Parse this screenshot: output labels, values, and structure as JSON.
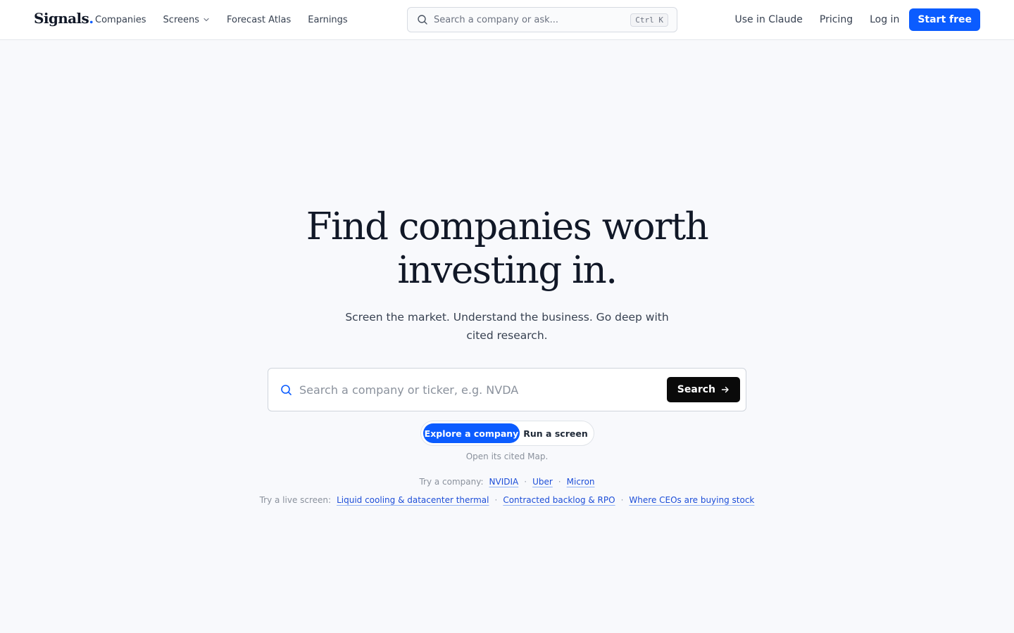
{
  "header": {
    "logo": "Signals",
    "logo_dot": ".",
    "nav": [
      {
        "label": "Companies"
      },
      {
        "label": "Screens"
      },
      {
        "label": "Forecast Atlas"
      },
      {
        "label": "Earnings"
      }
    ],
    "search": {
      "placeholder": "Search a company or ask...",
      "shortcut": "Ctrl K"
    },
    "right_links": [
      {
        "label": "Use in Claude"
      },
      {
        "label": "Pricing"
      },
      {
        "label": "Log in"
      }
    ],
    "cta": "Start free"
  },
  "hero": {
    "title_line1": "Find companies worth",
    "title_line2": "investing in.",
    "subtitle": "Screen the market. Understand the business. Go deep with cited research.",
    "search": {
      "placeholder": "Search a company or ticker, e.g. NVDA",
      "button": "Search"
    },
    "toggle": {
      "active": "Explore a company",
      "inactive": "Run a screen"
    },
    "hint": "Open its cited Map.",
    "try_company": {
      "label": "Try a company:",
      "links": [
        "NVIDIA",
        "Uber",
        "Micron"
      ]
    },
    "try_screen": {
      "label": "Try a live screen:",
      "links": [
        "Liquid cooling & datacenter thermal",
        "Contracted backlog & RPO",
        "Where CEOs are buying stock"
      ]
    }
  },
  "colors": {
    "accent": "#0b5cff",
    "background": "#f8f9fc",
    "text": "#111827"
  },
  "icons": [
    "search-icon",
    "chevron-down-icon",
    "arrow-right-icon"
  ]
}
